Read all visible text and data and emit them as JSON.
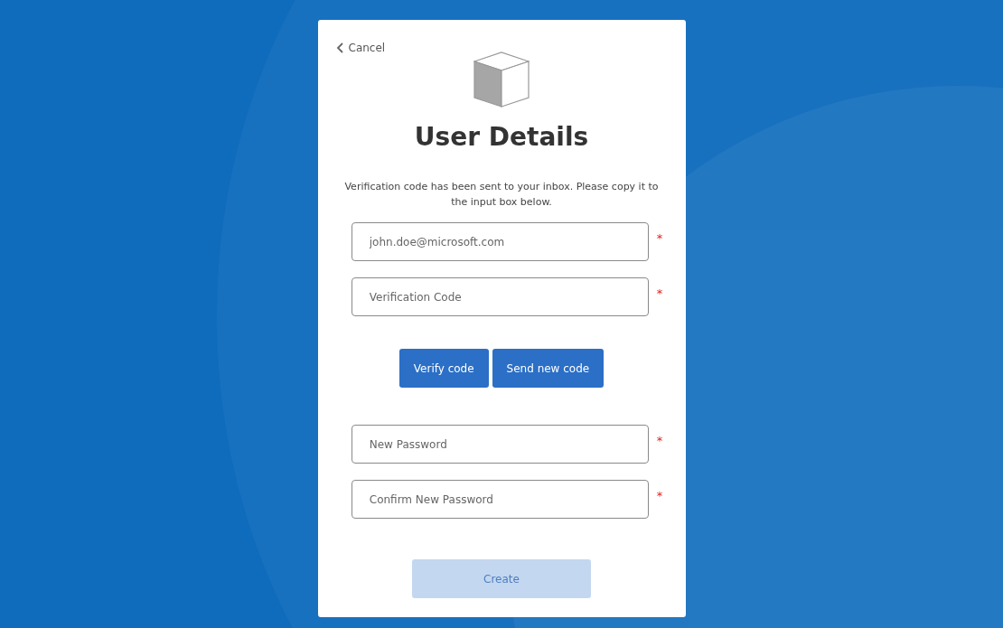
{
  "cancel_link": {
    "label": "Cancel"
  },
  "title": "User Details",
  "message": "Verification code has been sent to your inbox. Please copy it to the input box below.",
  "fields_top": [
    {
      "placeholder": "john.doe@microsoft.com",
      "required_mark": "*"
    },
    {
      "placeholder": "Verification Code",
      "required_mark": "*"
    }
  ],
  "code_buttons": [
    {
      "label": "Verify code"
    },
    {
      "label": "Send new code"
    }
  ],
  "fields_bottom": [
    {
      "placeholder": "New Password",
      "required_mark": "*"
    },
    {
      "placeholder": "Confirm New Password",
      "required_mark": "*"
    }
  ],
  "create_button": {
    "label": "Create",
    "disabled": true
  }
}
